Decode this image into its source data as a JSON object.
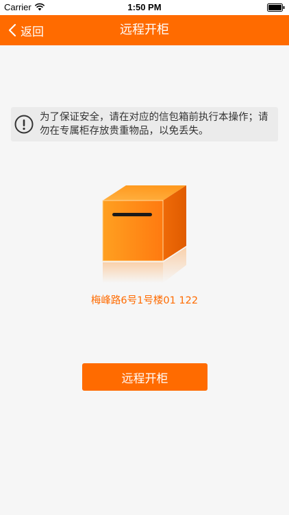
{
  "status_bar": {
    "carrier": "Carrier",
    "time": "1:50 PM",
    "wifi_icon": "wifi-icon",
    "battery_icon": "battery-icon"
  },
  "nav": {
    "back_label": "返回",
    "title": "远程开柜",
    "background_color": "#ff6b00"
  },
  "notice": {
    "icon": "alert-circle-icon",
    "text": "为了保证安全，请在对应的信包箱前执行本操作；请勿在专属柜存放贵重物品，以免丢失。"
  },
  "mailbox": {
    "icon": "mailbox-icon",
    "address": "梅峰路6号1号楼01 122"
  },
  "actions": {
    "open_button_label": "远程开柜"
  },
  "colors": {
    "accent": "#ff6b00",
    "background": "#f6f6f6",
    "notice_bg": "#ebebeb"
  }
}
